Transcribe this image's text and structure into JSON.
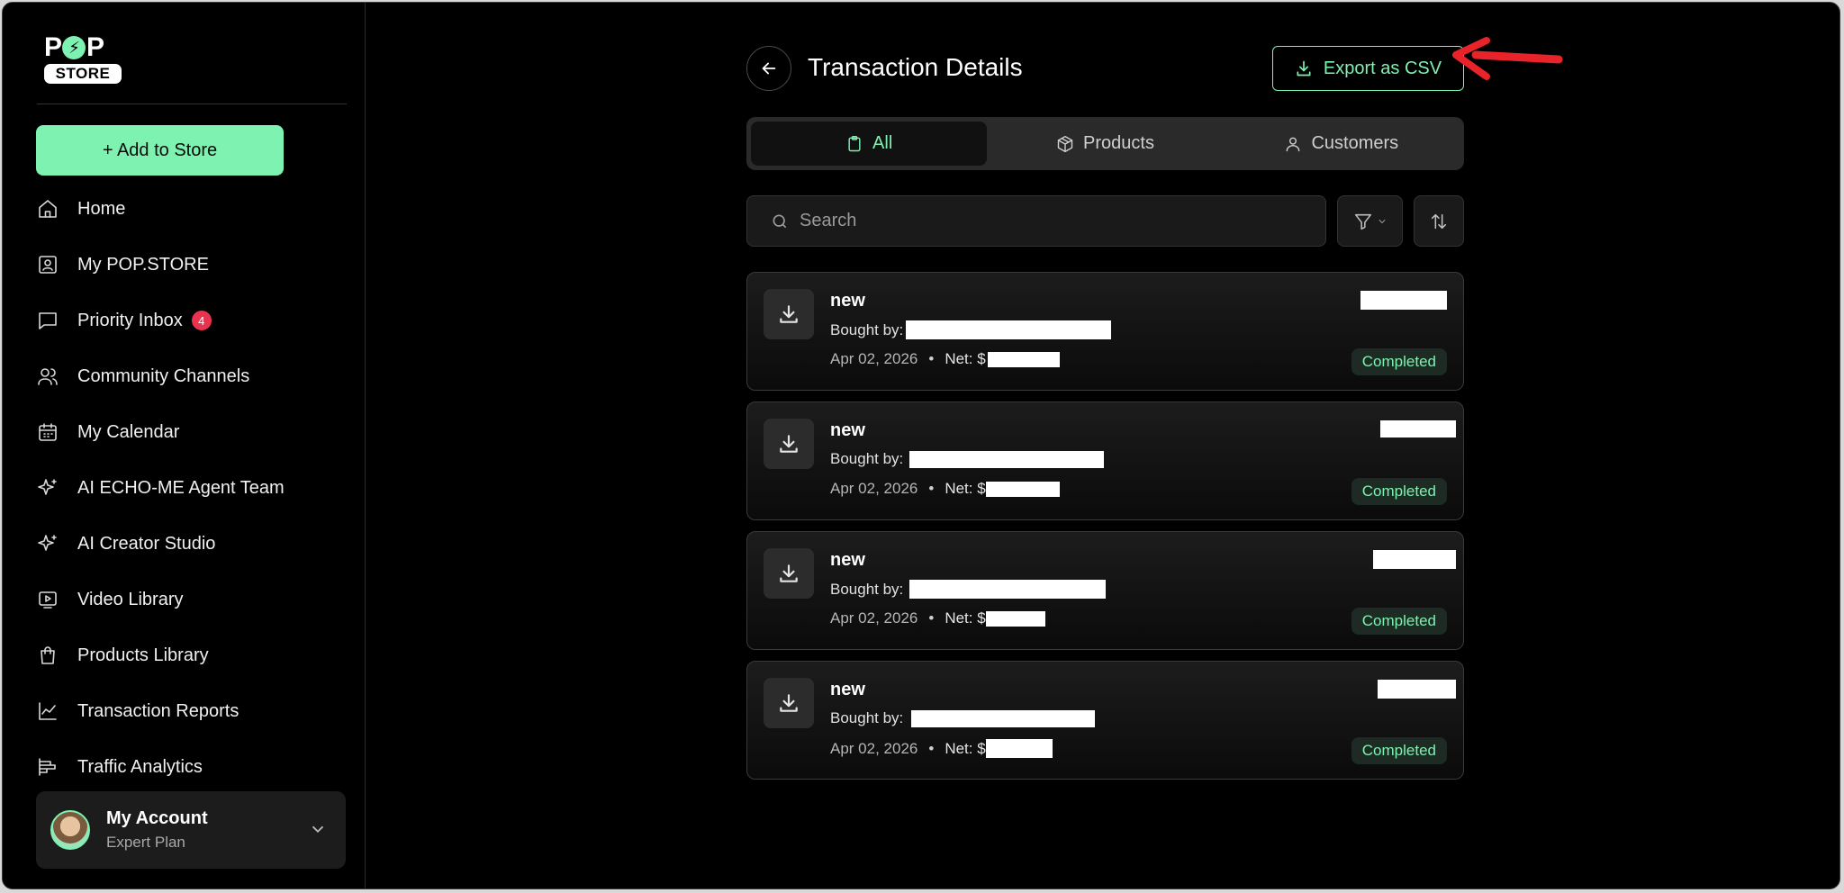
{
  "sidebar": {
    "logo_top": "POP",
    "logo_bottom": "STORE",
    "add_button": "+ Add to Store",
    "items": [
      {
        "label": "Home",
        "icon": "home-icon"
      },
      {
        "label": "My POP.STORE",
        "icon": "store-profile-icon"
      },
      {
        "label": "Priority Inbox",
        "icon": "message-icon",
        "badge": "4"
      },
      {
        "label": "Community Channels",
        "icon": "users-icon"
      },
      {
        "label": "My Calendar",
        "icon": "calendar-icon"
      },
      {
        "label": "AI ECHO-ME Agent Team",
        "icon": "sparkles-icon"
      },
      {
        "label": "AI Creator Studio",
        "icon": "sparkles-icon"
      },
      {
        "label": "Video Library",
        "icon": "video-icon"
      },
      {
        "label": "Products Library",
        "icon": "shopping-bag-icon"
      },
      {
        "label": "Transaction Reports",
        "icon": "chart-line-icon"
      },
      {
        "label": "Traffic Analytics",
        "icon": "bar-chart-icon"
      }
    ],
    "account": {
      "name": "My Account",
      "plan": "Expert Plan"
    }
  },
  "header": {
    "title": "Transaction Details",
    "export_label": "Export as CSV"
  },
  "tabs": [
    {
      "label": "All",
      "icon": "clipboard-icon",
      "active": true
    },
    {
      "label": "Products",
      "icon": "box-icon",
      "active": false
    },
    {
      "label": "Customers",
      "icon": "user-icon",
      "active": false
    }
  ],
  "search": {
    "placeholder": "Search"
  },
  "transactions": [
    {
      "name": "new",
      "bought_by_label": "Bought by:",
      "date": "Apr 02, 2026",
      "net_label": "Net: $",
      "status": "Completed"
    },
    {
      "name": "new",
      "bought_by_label": "Bought by:",
      "date": "Apr 02, 2026",
      "net_label": "Net: $",
      "status": "Completed"
    },
    {
      "name": "new",
      "bought_by_label": "Bought by:",
      "date": "Apr 02, 2026",
      "net_label": "Net: $",
      "status": "Completed"
    },
    {
      "name": "new",
      "bought_by_label": "Bought by:",
      "date": "Apr 02, 2026",
      "net_label": "Net: $",
      "status": "Completed"
    }
  ],
  "colors": {
    "accent": "#7ef2b0",
    "badge": "#e8344e",
    "annotation_arrow": "#e8232a",
    "background": "#000000"
  }
}
